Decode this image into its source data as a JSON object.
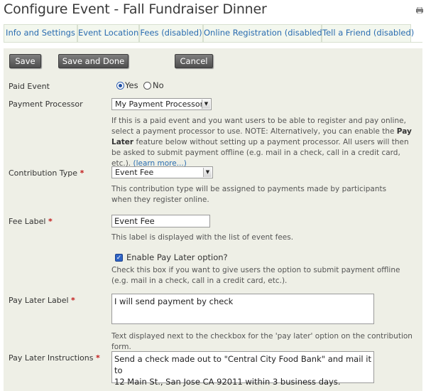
{
  "page": {
    "title": "Configure Event - Fall Fundraiser Dinner"
  },
  "icons": {
    "print": "printer-icon"
  },
  "tabs": [
    {
      "label": "Info and Settings"
    },
    {
      "label": "Event Location"
    },
    {
      "label": "Fees (disabled)"
    },
    {
      "label": "Online Registration (disabled)"
    },
    {
      "label": "Tell a Friend (disabled)"
    }
  ],
  "toolbar": {
    "save_label": "Save",
    "save_done_label": "Save and Done",
    "cancel_label": "Cancel"
  },
  "form": {
    "paid_event": {
      "label": "Paid Event",
      "yes_label": "Yes",
      "no_label": "No",
      "selected": "Yes"
    },
    "payment_processor": {
      "label": "Payment Processor",
      "value": "My Payment Processor",
      "help_part1": "If this is a paid event and you want users to be able to register and pay online, select a payment processor to use. NOTE: Alternatively, you can enable the ",
      "help_bold": "Pay Later",
      "help_part2": " feature below without setting up a payment processor. All users will then be asked to submit payment offline (e.g. mail in a check, call in a credit card, etc.). ",
      "help_link": "(learn more...)"
    },
    "contribution_type": {
      "label": "Contribution Type",
      "required_mark": "*",
      "value": "Event Fee",
      "help": "This contribution type will be assigned to payments made by participants when they register online."
    },
    "fee_label": {
      "label": "Fee Label",
      "required_mark": "*",
      "value": "Event Fee",
      "help": "This label is displayed with the list of event fees."
    },
    "pay_later_option": {
      "label": "Enable Pay Later option?",
      "checked": true,
      "help": "Check this box if you want to give users the option to submit payment offline (e.g. mail in a check, call in a credit card, etc.)."
    },
    "pay_later_label": {
      "label": "Pay Later Label",
      "required_mark": "*",
      "value": "I will send payment by check",
      "help": "Text displayed next to the checkbox for the 'pay later' option on the contribution form."
    },
    "pay_later_instructions": {
      "label": "Pay Later Instructions",
      "required_mark": "*",
      "value_line1": "Send a check made out to \"Central City Food Bank\" and mail it to",
      "value_line2": "12 Main St., San Jose CA 92011 within 3 business days."
    }
  },
  "colors": {
    "accent_link": "#2a6cb0",
    "required": "#c21b1b",
    "panel_bg": "#eeefe6"
  }
}
